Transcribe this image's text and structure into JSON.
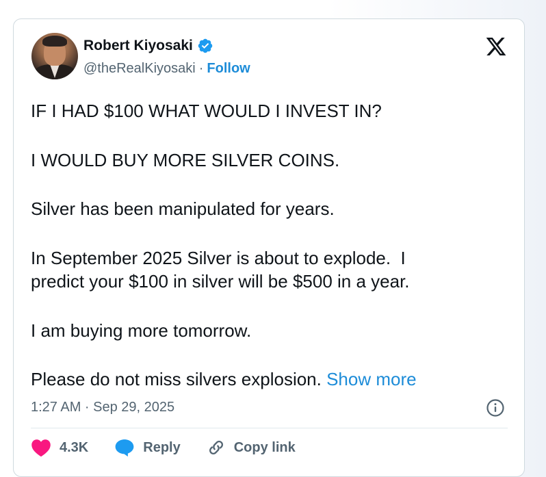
{
  "author": {
    "name": "Robert Kiyosaki",
    "handle": "@theRealKiyosaki",
    "separator": "·",
    "follow_label": "Follow",
    "verified_color": "#1d9bf0"
  },
  "post": {
    "paragraphs": [
      "IF I HAD $100 WHAT WOULD I INVEST IN?",
      "I WOULD BUY MORE SILVER COINS.",
      "Silver has been manipulated for years.",
      "In September 2025 Silver is about to explode.  I\npredict your $100 in silver will be $500 in a year.",
      "I am buying more tomorrow."
    ],
    "last_paragraph": "Please do not miss silvers explosion. ",
    "show_more_label": "Show more",
    "timestamp": "1:27 AM · Sep 29, 2025"
  },
  "actions": {
    "likes": "4.3K",
    "reply_label": "Reply",
    "copy_link_label": "Copy link"
  },
  "icons": {
    "brand": "x-logo-icon",
    "verified": "verified-badge-icon",
    "info": "info-icon",
    "like": "heart-icon",
    "reply": "speech-bubble-icon",
    "copy_link": "link-icon"
  },
  "colors": {
    "accent": "#1d8cd8",
    "like": "#f91880",
    "muted": "#536471",
    "text": "#0f1419"
  }
}
